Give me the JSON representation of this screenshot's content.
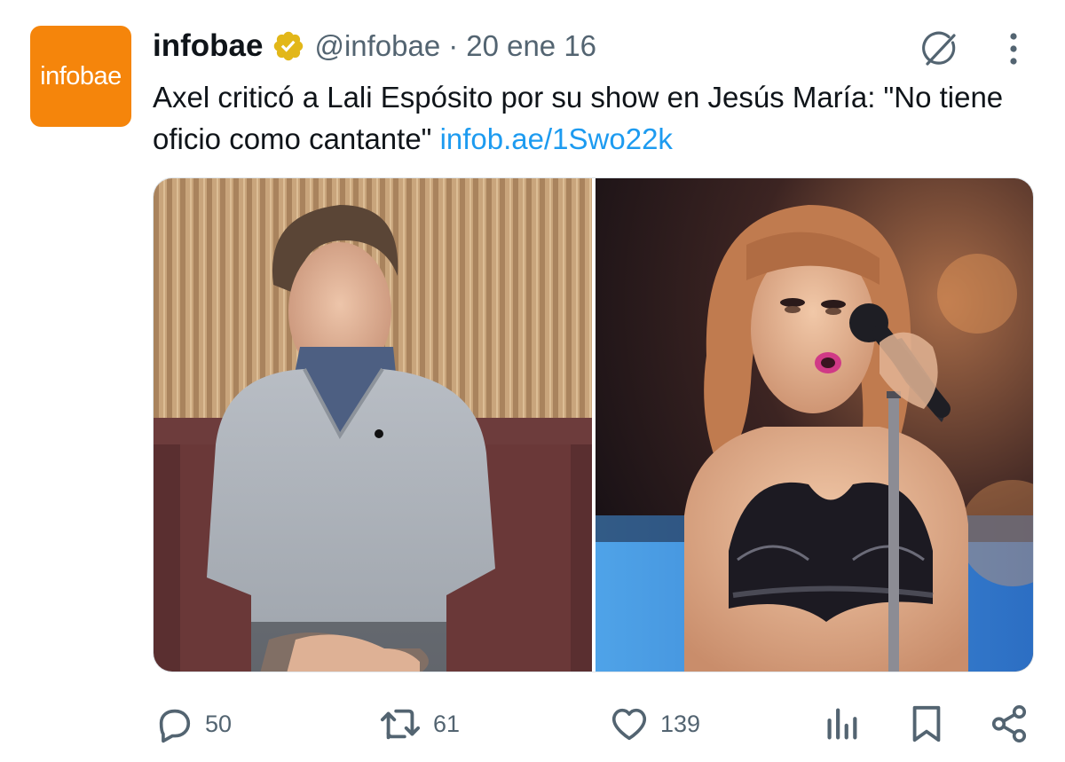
{
  "tweet": {
    "avatar_text": "infobae",
    "display_name": "infobae",
    "handle": "@infobae",
    "separator": "·",
    "date": "20 ene 16",
    "text": "Axel criticó a Lali Espósito por su show en Jesús María: \"No tiene oficio como cantante\"",
    "link": "infob.ae/1Swo22k"
  },
  "icons": {
    "verified": "verified-badge-icon",
    "grok": "grok-icon",
    "more": "more-options-icon",
    "reply": "reply-icon",
    "retweet": "retweet-icon",
    "like": "heart-icon",
    "views": "views-icon",
    "bookmark": "bookmark-icon",
    "share": "share-icon"
  },
  "actions": {
    "replies": "50",
    "retweets": "61",
    "likes": "139"
  },
  "colors": {
    "brand_orange": "#f5850b",
    "verified_gold": "#e2b719",
    "link_blue": "#1d9bf0",
    "muted_gray": "#536471"
  }
}
